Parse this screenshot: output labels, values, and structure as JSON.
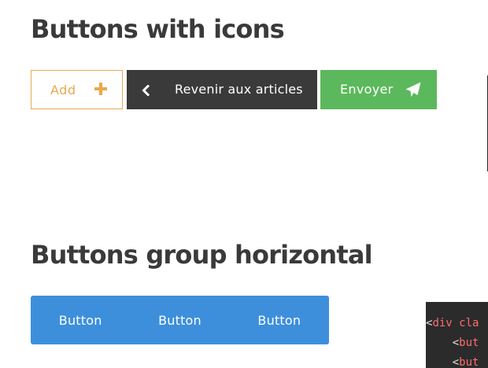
{
  "sections": {
    "icons_title": "Buttons with icons",
    "group_title": "Buttons group horizontal"
  },
  "icon_buttons": {
    "add": {
      "label": "Add",
      "icon": "plus-icon",
      "color": "#e8a94f"
    },
    "back": {
      "label": "Revenir aux articles",
      "icon": "chevron-left-icon",
      "color": "#3a3a3a"
    },
    "send": {
      "label": "Envoyer",
      "icon": "paper-plane-icon",
      "color": "#5cb85c"
    }
  },
  "button_group": {
    "color": "#3d8fdc",
    "buttons": [
      "Button",
      "Button",
      "Button"
    ]
  },
  "code_snippet": {
    "lines": [
      {
        "open": "<",
        "tag": "div",
        "rest": " cla"
      },
      {
        "open": "    <",
        "tag": "but",
        "rest": ""
      },
      {
        "open": "    <",
        "tag": "but",
        "rest": ""
      }
    ]
  }
}
